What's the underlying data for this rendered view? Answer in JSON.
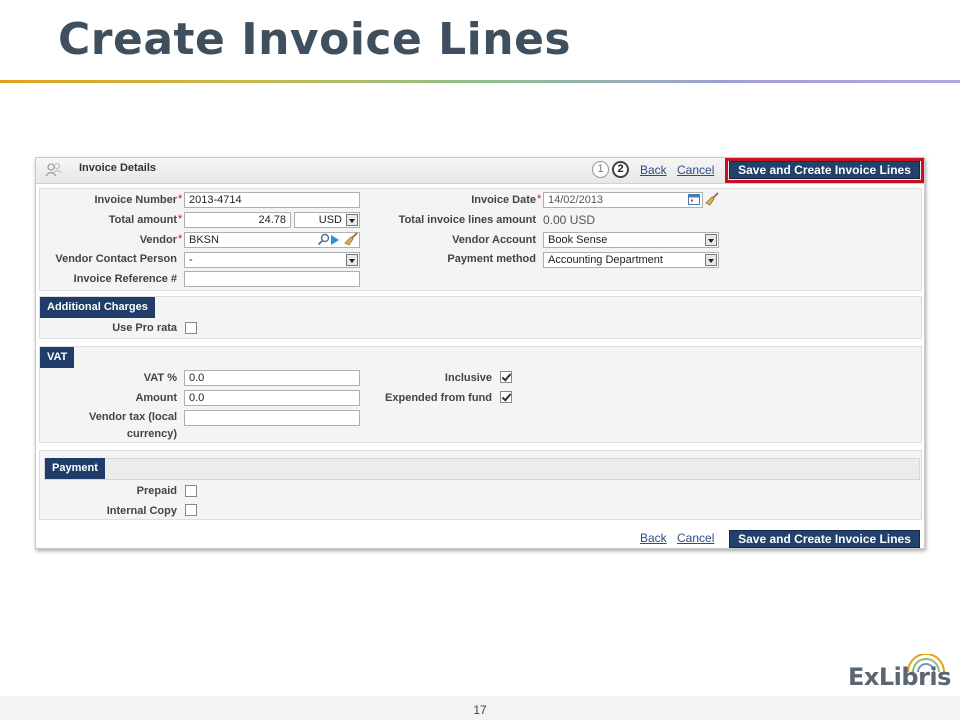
{
  "slide": {
    "title": "Create Invoice Lines",
    "page_number": "17",
    "logo_text": "ExLibris"
  },
  "header": {
    "title": "Invoice Details",
    "step1": "1",
    "step2": "2",
    "back": "Back",
    "cancel": "Cancel",
    "save": "Save and Create Invoice Lines"
  },
  "details": {
    "invoice_number_label": "Invoice Number",
    "invoice_number": "2013-4714",
    "total_amount_label": "Total amount",
    "total_amount": "24.78",
    "currency": "USD",
    "vendor_label": "Vendor",
    "vendor": "BKSN",
    "vendor_contact_label": "Vendor Contact Person",
    "vendor_contact": "-",
    "invoice_reference_label": "Invoice Reference #",
    "invoice_reference": "",
    "invoice_date_label": "Invoice Date",
    "invoice_date": "14/02/2013",
    "total_lines_label": "Total invoice lines amount",
    "total_lines": "0.00 USD",
    "vendor_account_label": "Vendor Account",
    "vendor_account": "Book Sense",
    "payment_method_label": "Payment method",
    "payment_method": "Accounting Department"
  },
  "additional_charges": {
    "tab": "Additional Charges",
    "use_pro_rata_label": "Use Pro rata",
    "use_pro_rata": false
  },
  "vat": {
    "tab": "VAT",
    "vat_pct_label": "VAT %",
    "vat_pct": "0.0",
    "amount_label": "Amount",
    "amount": "0.0",
    "vendor_tax_label_1": "Vendor tax (local",
    "vendor_tax_label_2": "currency)",
    "vendor_tax": "",
    "inclusive_label": "Inclusive",
    "inclusive": true,
    "expended_label": "Expended from fund",
    "expended": true
  },
  "payment": {
    "tab": "Payment",
    "prepaid_label": "Prepaid",
    "prepaid": false,
    "internal_copy_label": "Internal Copy",
    "internal_copy": false
  },
  "footer": {
    "back": "Back",
    "cancel": "Cancel",
    "save": "Save and Create Invoice Lines"
  },
  "colors": {
    "title": "#3f4f5d",
    "primary_button": "#22416b",
    "section_tab": "#1f3d68",
    "link": "#2a4f86",
    "highlight": "#c8101e",
    "required": "#c8101e"
  }
}
